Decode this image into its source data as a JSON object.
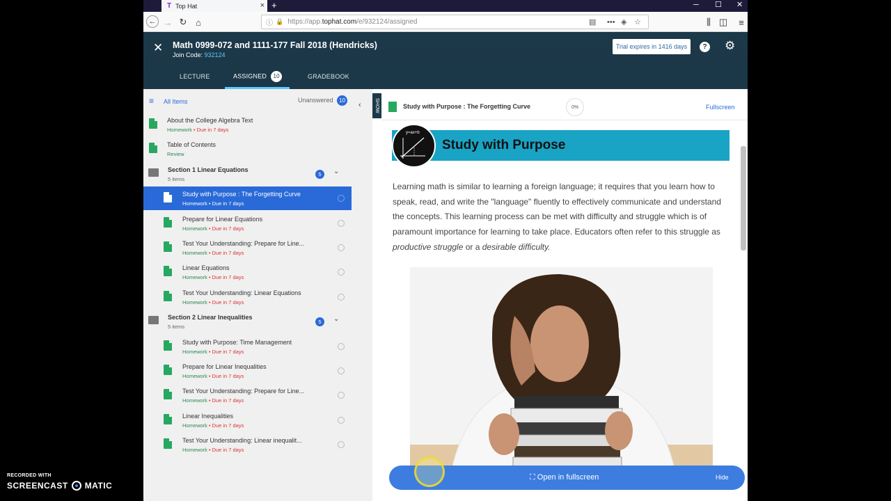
{
  "browser": {
    "tab_title": "Top Hat",
    "url_prefix": "https://app.",
    "url_host": "tophat.com",
    "url_path": "/e/932124/assigned",
    "new_tab": "+",
    "minimize": "─",
    "maximize": "☐",
    "close": "✕"
  },
  "header": {
    "course_title": "Math 0999-072 and 1111-177 Fall 2018 (Hendricks)",
    "join_label": "Join Code: ",
    "join_code": "932124",
    "trial": "Trial expires in 1416 days",
    "help": "?",
    "tabs": [
      {
        "label": "LECTURE"
      },
      {
        "label": "ASSIGNED",
        "count": "10"
      },
      {
        "label": "GRADEBOOK"
      }
    ]
  },
  "sidebar": {
    "filter_label": "All Items",
    "unanswered_label": "Unanswered",
    "unanswered_count": "10",
    "items": [
      {
        "title": "About the College Algebra Text",
        "type": "Homework",
        "due": "Due in 7 days"
      },
      {
        "title": "Table of Contents",
        "type": "Review"
      },
      {
        "section": true,
        "title": "Section 1 Linear Equations",
        "sub": "5 items",
        "count": "5"
      },
      {
        "title": "Study with Purpose : The Forgetting Curve",
        "type": "Homework",
        "due": "Due in 7 days",
        "selected": true
      },
      {
        "title": "Prepare for Linear Equations",
        "type": "Homework",
        "due": "Due in 7 days"
      },
      {
        "title": "Test Your Understanding: Prepare for Line...",
        "type": "Homework",
        "due": "Due in 7 days"
      },
      {
        "title": "Linear Equations",
        "type": "Homework",
        "due": "Due in 7 days"
      },
      {
        "title": "Test Your Understanding: Linear Equations",
        "type": "Homework",
        "due": "Due in 7 days"
      },
      {
        "section": true,
        "title": "Section 2 Linear Inequalities",
        "sub": "5 items",
        "count": "5"
      },
      {
        "title": "Study with Purpose: Time Management",
        "type": "Homework",
        "due": "Due in 7 days"
      },
      {
        "title": "Prepare for Linear Inequalities",
        "type": "Homework",
        "due": "Due in 7 days"
      },
      {
        "title": "Test Your Understanding: Prepare for Line...",
        "type": "Homework",
        "due": "Due in 7 days"
      },
      {
        "title": "Linear Inequalities",
        "type": "Homework",
        "due": "Due in 7 days"
      },
      {
        "title": "Test Your Understanding: Linear inequalit...",
        "type": "Homework",
        "due": "Due in 7 days"
      }
    ]
  },
  "show_label": "SHOW",
  "content": {
    "title": "Study with Purpose : The Forgetting Curve",
    "progress": "0%",
    "fullscreen_link": "Fullscreen",
    "banner_text": "Study with Purpose",
    "logo_formula": "y=ax+b",
    "para_main": "Learning math is similar to learning a foreign language; it requires that you learn how to speak, read, and write the \"language\" fluently to effectively communicate and understand the concepts. This learning process can be met with difficulty and struggle which is of paramount importance for learning to take place. Educators often refer to this struggle as ",
    "para_em1": "productive struggle",
    "para_or": " or a ",
    "para_em2": "desirable difficulty.",
    "open_fullscreen": "Open in fullscreen",
    "hide": "Hide"
  },
  "watermark": {
    "small": "RECORDED WITH",
    "left": "SCREENCAST",
    "right": "MATIC"
  },
  "colors": {
    "accent": "#2a6ad8",
    "header_bg": "#1c3949",
    "banner": "#19a3c4",
    "homework_green": "#27a861",
    "due_red": "#d33333"
  }
}
